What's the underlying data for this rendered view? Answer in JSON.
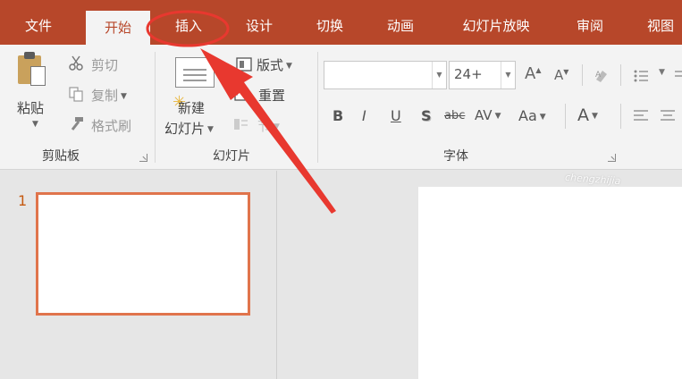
{
  "tabs": {
    "file": "文件",
    "home": "开始",
    "insert": "插入",
    "design": "设计",
    "transitions": "切换",
    "animations": "动画",
    "slideshow": "幻灯片放映",
    "review": "审阅",
    "view": "视图"
  },
  "active_tab": "开始",
  "clipboard": {
    "paste": "粘贴",
    "cut": "剪切",
    "copy": "复制",
    "format_painter": "格式刷",
    "group_label": "剪贴板"
  },
  "slides": {
    "new_slide_line1": "新建",
    "new_slide_line2": "幻灯片",
    "layout": "版式",
    "reset": "重置",
    "section": "节",
    "group_label": "幻灯片"
  },
  "font": {
    "font_name": "",
    "font_size": "24+",
    "grow": "A",
    "shrink": "A",
    "bold": "B",
    "italic": "I",
    "underline": "U",
    "shadow": "S",
    "strike": "abc",
    "spacing": "AV",
    "case": "Aa",
    "color": "A",
    "group_label": "字体"
  },
  "thumbnail": {
    "number": "1"
  },
  "watermark": "chengzhijia",
  "colors": {
    "accent": "#b7472a",
    "annotation": "#e8382f",
    "thumb_border": "#e0744c"
  }
}
